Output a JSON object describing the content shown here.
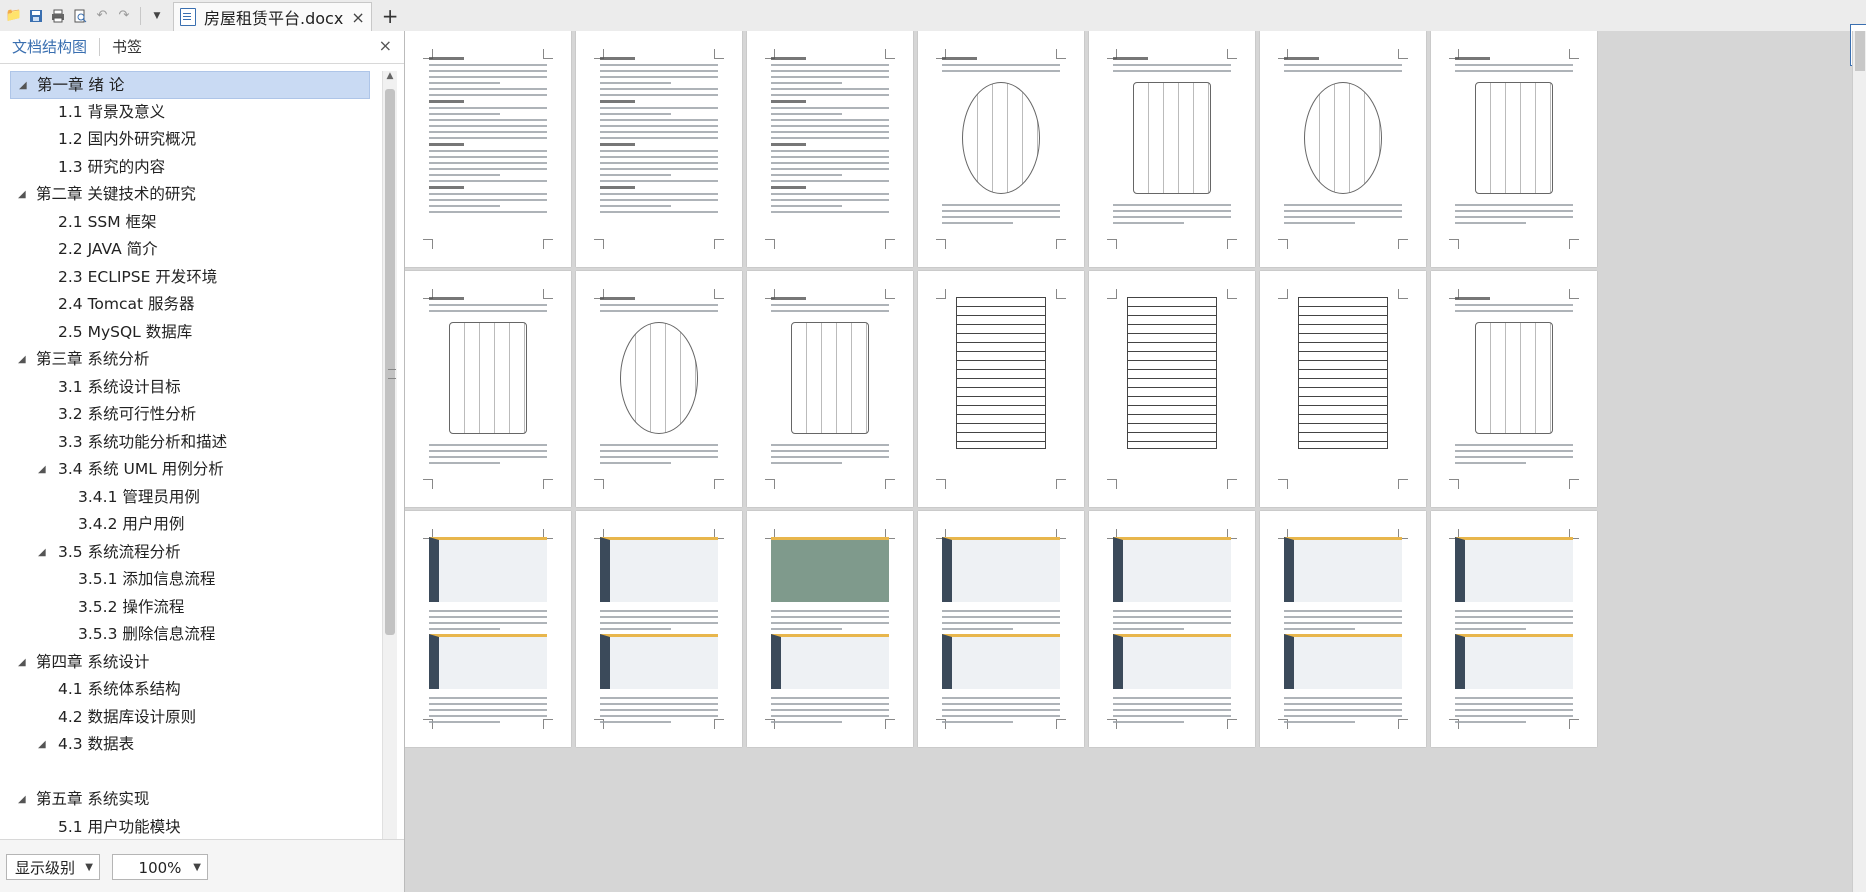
{
  "window": {
    "doc_tab_title": "房屋租赁平台.docx",
    "tab_close": "×",
    "new_tab": "+"
  },
  "toolbar": {
    "icons": [
      "open-folder-icon",
      "save-icon",
      "print-icon",
      "print-preview-icon",
      "undo-icon",
      "redo-icon",
      "dropdown-icon"
    ]
  },
  "nav_pane": {
    "tabs": [
      "文档结构图",
      "书签"
    ],
    "close": "×",
    "items": [
      {
        "level": 1,
        "label": "第一章  绪  论",
        "expanded": true,
        "selected": true
      },
      {
        "level": 2,
        "label": "1.1 背景及意义"
      },
      {
        "level": 2,
        "label": "1.2 国内外研究概况"
      },
      {
        "level": 2,
        "label": "1.3  研究的内容"
      },
      {
        "level": 1,
        "label": "第二章  关键技术的研究",
        "expanded": true
      },
      {
        "level": 2,
        "label": "2.1 SSM 框架"
      },
      {
        "level": 2,
        "label": "2.2 JAVA 简介"
      },
      {
        "level": 2,
        "label": "2.3 ECLIPSE  开发环境"
      },
      {
        "level": 2,
        "label": "2.4 Tomcat 服务器"
      },
      {
        "level": 2,
        "label": "2.5 MySQL 数据库"
      },
      {
        "level": 1,
        "label": "第三章  系统分析",
        "expanded": true
      },
      {
        "level": 2,
        "label": "3.1  系统设计目标"
      },
      {
        "level": 2,
        "label": "3.2  系统可行性分析"
      },
      {
        "level": 2,
        "label": "3.3  系统功能分析和描述"
      },
      {
        "level": 2,
        "label": "3.4 系统 UML 用例分析",
        "expanded": true
      },
      {
        "level": 3,
        "label": "3.4.1 管理员用例"
      },
      {
        "level": 3,
        "label": "3.4.2 用户用例"
      },
      {
        "level": 2,
        "label": "3.5 系统流程分析",
        "expanded": true
      },
      {
        "level": 3,
        "label": "3.5.1 添加信息流程"
      },
      {
        "level": 3,
        "label": "3.5.2 操作流程"
      },
      {
        "level": 3,
        "label": "3.5.3 删除信息流程"
      },
      {
        "level": 1,
        "label": "第四章  系统设计",
        "expanded": true
      },
      {
        "level": 2,
        "label": "4.1  系统体系结构"
      },
      {
        "level": 2,
        "label": "4.2  数据库设计原则"
      },
      {
        "level": 2,
        "label": "4.3  数据表",
        "expanded": true
      },
      {
        "level": 0,
        "label": ""
      },
      {
        "level": 1,
        "label": "第五章  系统实现",
        "expanded": true
      },
      {
        "level": 2,
        "label": "5.1 用户功能模块"
      }
    ],
    "display_level_label": "显示级别",
    "zoom_value": "100%"
  },
  "pages": {
    "rows": 3,
    "cols": 7
  }
}
